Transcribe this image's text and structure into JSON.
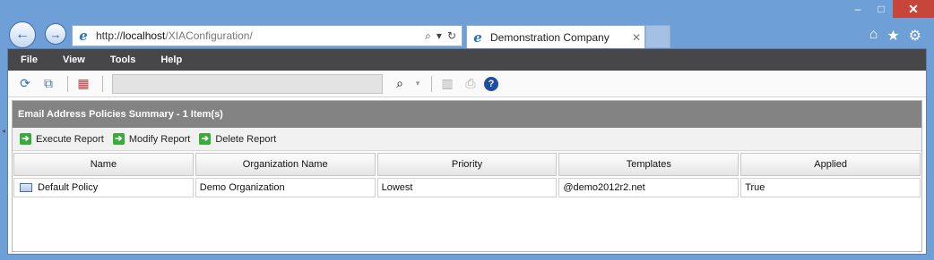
{
  "browser": {
    "url_prefix": "http://",
    "url_host": "localhost",
    "url_path": "/XIAConfiguration/",
    "tab_title": "Demonstration Company",
    "tab_close": "✕",
    "window_controls": {
      "minimize": "–",
      "maximize": "□",
      "close": "✕"
    }
  },
  "menu": [
    "File",
    "View",
    "Tools",
    "Help"
  ],
  "panel": {
    "title": "Email Address Policies Summary - 1 Item(s)",
    "actions": [
      "Execute Report",
      "Modify Report",
      "Delete Report"
    ]
  },
  "table": {
    "columns": [
      "Name",
      "Organization Name",
      "Priority",
      "Templates",
      "Applied"
    ],
    "rows": [
      [
        "Default Policy",
        "Demo Organization",
        "Lowest",
        "@demo2012r2.net",
        "True"
      ]
    ]
  },
  "colors": {
    "menubar": "#474749",
    "panel_header": "#838383",
    "window_frame": "#6e9fd6",
    "action_icon": "#3aaa3a"
  }
}
